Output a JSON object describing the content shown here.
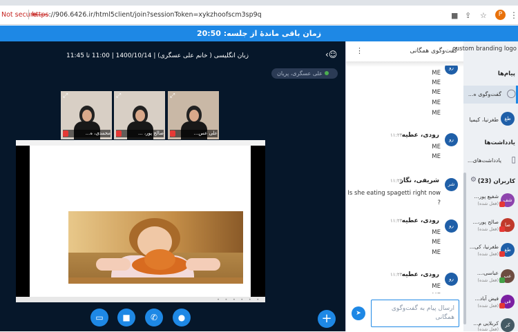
{
  "browser": {
    "security_label": "Not secure",
    "url_scheme": "https",
    "url_rest": "://906.6426.ir/html5client/join?sessionToken=xykzhoofscm3sp9q",
    "profile_initial": "P"
  },
  "timer": {
    "text": "زمان باقی ماندهٔ از جلسه: 20:50"
  },
  "session": {
    "title": "زبان انگلیسی ( خانم علی عسگری) | 1400/10/14 | 11:00 تا 11:45",
    "presenter": "علی عسگری، پریان"
  },
  "webcams": [
    {
      "name": "محمدی، ه..."
    },
    {
      "name": "صالح پور، ..."
    },
    {
      "name": "علی عس..."
    }
  ],
  "colors": {
    "accent": "#1e88e5",
    "main_bg": "#06172a",
    "sidebar_bg": "#edf0f4",
    "mute": "#e53935"
  },
  "controls": [
    {
      "icon": "screen-share-icon"
    },
    {
      "icon": "camera-icon"
    },
    {
      "icon": "phone-icon"
    },
    {
      "icon": "mic-icon"
    }
  ],
  "chat": {
    "header": "گفت‌وگوی همگانی",
    "lines_top": [
      "ME",
      "ME",
      "ME",
      "ME",
      "ME"
    ],
    "messages": [
      {
        "avatar": "رو",
        "sender": "رودی، عطیه",
        "time": "۱۱:۲۳",
        "lines": [
          "ME",
          "ME"
        ]
      },
      {
        "avatar": "شر",
        "sender": "شریفی، نگار",
        "time": "۱۱:۲۳",
        "lines": [
          "Is she eating spagetti right now",
          "?"
        ]
      },
      {
        "avatar": "رو",
        "sender": "رودی، عطیه",
        "time": "۱۱:۲۳",
        "lines": [
          "ME",
          "ME",
          "ME"
        ]
      },
      {
        "avatar": "رو",
        "sender": "رودی، عطیه",
        "time": "۱۱:۲۳",
        "lines": [
          "ME",
          "ME"
        ]
      }
    ],
    "input_placeholder": "ارسال پیام به گفت‌وگوی همگانی"
  },
  "sidebar": {
    "logo_alt": "custom branding logo",
    "messages_heading": "پیام‌ها",
    "public_chat": "گفت‌وگوی ه...",
    "private_chat": "طغرنیا، کیمیا",
    "private_avatar": "طغ",
    "notes_heading": "یادداشت‌ها",
    "shared_notes": "یادداشت‌های...",
    "users_heading": "کاربران (23)",
    "users": [
      {
        "avatar": "شف",
        "name": "شفیع پور...",
        "status": "(فعل شده)",
        "color": "#8e44ad"
      },
      {
        "avatar": "صا",
        "name": "صالح پور،...",
        "status": "(فعل شده)",
        "color": "#c0392b"
      },
      {
        "avatar": "طغ",
        "name": "طغرنیا، کی...",
        "status": "(فعل شده)",
        "color": "#1f5fa8"
      },
      {
        "avatar": "عب",
        "name": "عباسی،...",
        "status": "(فعل شده)",
        "color": "#6d4c41"
      },
      {
        "avatar": "فی",
        "name": "فیض آباد...",
        "status": "(فعل شده)",
        "color": "#7b1fa2"
      },
      {
        "avatar": "کر",
        "name": "کربلایی م...",
        "status": "(فعل شده)",
        "color": "#455a64"
      }
    ]
  }
}
